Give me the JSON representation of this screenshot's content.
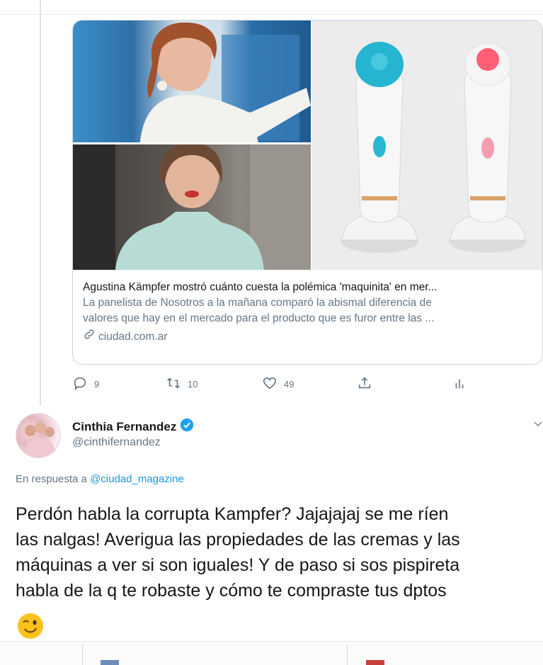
{
  "card": {
    "title": "Agustina Kämpfer mostró cuánto cuesta la polémica 'maquinita' en mer...",
    "description_line1": "La panelista de Nosotros a la mañana comparó la abismal diferencia de",
    "description_line2": "valores que hay en el mercado para el producto que es furor entre las ...",
    "domain": "ciudad.com.ar"
  },
  "actions": {
    "replies": "9",
    "retweets": "10",
    "likes": "49"
  },
  "tweet": {
    "display_name": "Cinthia Fernandez",
    "handle": "@cinthifernandez",
    "reply_prefix": "En respuesta a",
    "reply_handle": "@ciudad_magazine",
    "text_lines": [
      "Perdón habla la corrupta Kampfer? Jajajajaj se me ríen",
      "las nalgas! Averigua las propiedades de las cremas y las",
      "máquinas a ver si son iguales! Y de paso si sos pispireta",
      "habla de la q te robaste y cómo te compraste tus dptos"
    ]
  },
  "colors": {
    "link": "#1b95e0",
    "secondary_text": "#657786",
    "verified": "#1da1f2",
    "border": "#ccd6dd"
  },
  "icons": [
    "reply-icon",
    "retweet-icon",
    "like-icon",
    "share-icon",
    "analytics-icon",
    "link-icon",
    "verified-badge-icon",
    "chevron-down-icon",
    "winking-face-emoji"
  ]
}
